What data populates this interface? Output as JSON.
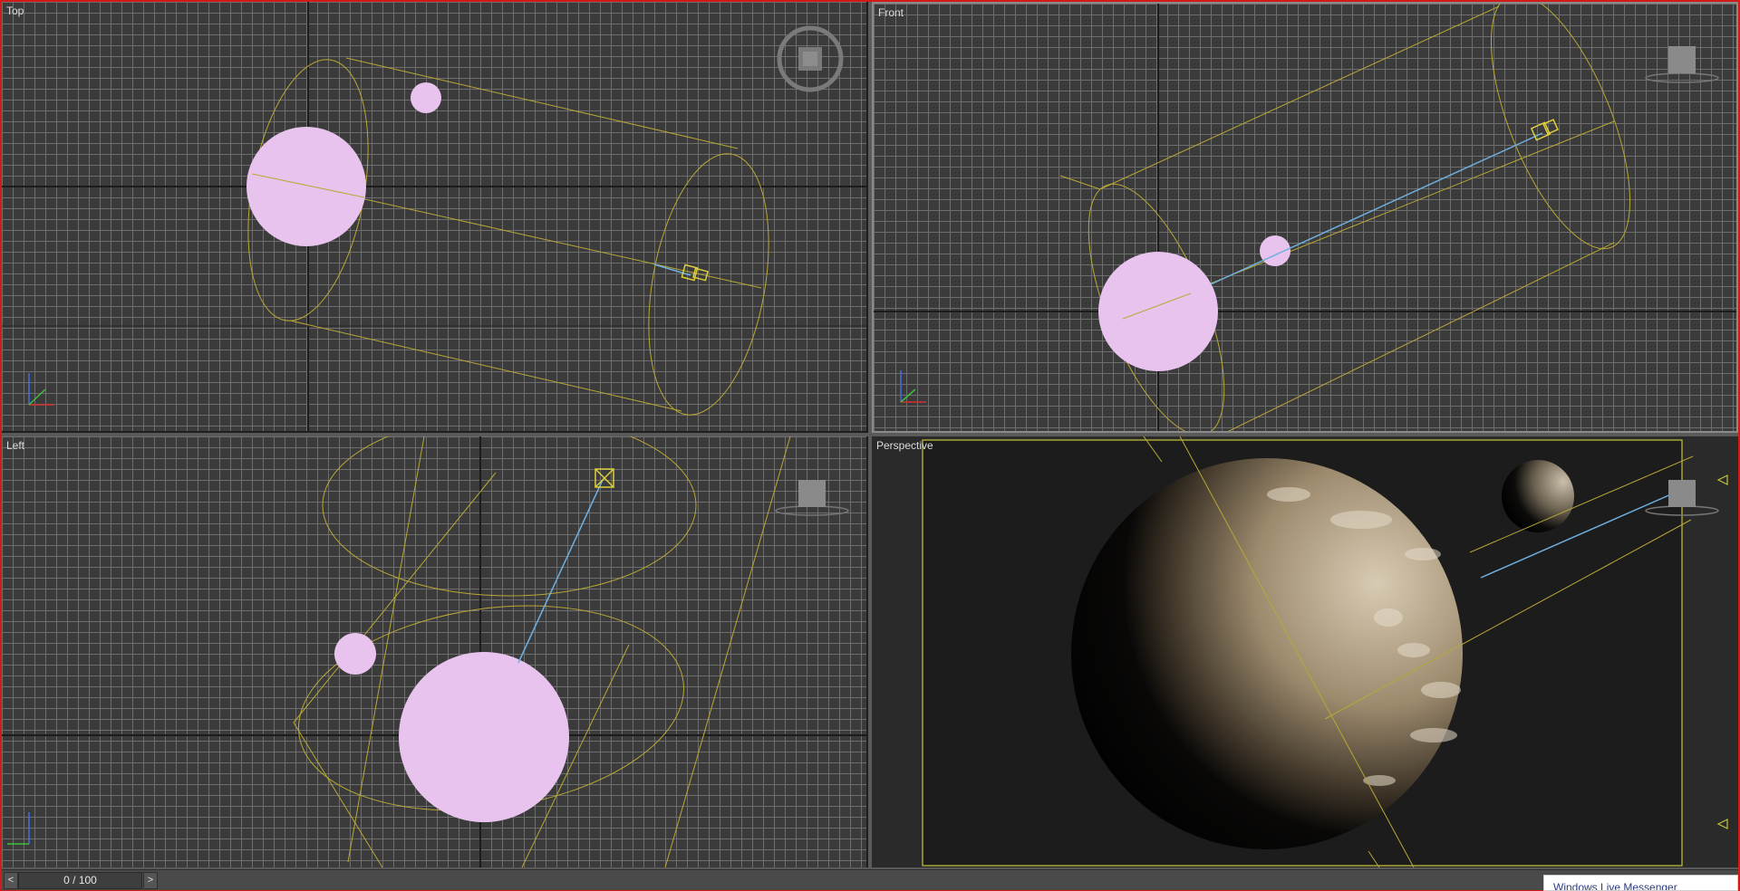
{
  "viewports": {
    "top": {
      "label": "Top"
    },
    "front": {
      "label": "Front"
    },
    "left": {
      "label": "Left"
    },
    "perspective": {
      "label": "Perspective"
    }
  },
  "timeline": {
    "frame_display": "0 / 100",
    "prev_symbol": "<",
    "next_symbol": ">"
  },
  "notification": {
    "text": "Windows Live Messenger"
  },
  "colors": {
    "frame_border": "#d21a1a",
    "grid_line": "#6e6e6e",
    "viewport_bg": "#3b3b3b",
    "sphere_fill": "#e8c3ee",
    "helper_wire": "#b8a836",
    "target_line": "#6fb0e0",
    "safe_frame": "#c8c23a"
  },
  "icons": [
    "viewcube-icon",
    "axis-tripod-icon",
    "camera-icon",
    "light-target-icon"
  ]
}
